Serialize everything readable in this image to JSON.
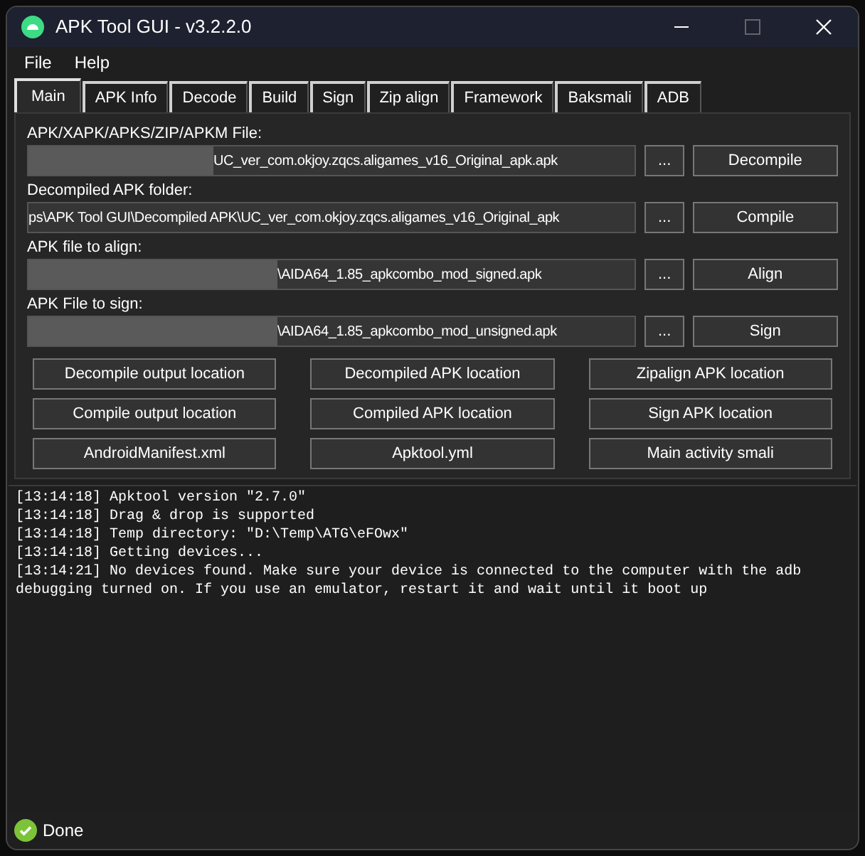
{
  "window": {
    "title": "APK Tool GUI - v3.2.2.0"
  },
  "menu": [
    "File",
    "Help"
  ],
  "tabs": [
    {
      "label": "Main",
      "selected": true
    },
    {
      "label": "APK Info",
      "selected": false
    },
    {
      "label": "Decode",
      "selected": false
    },
    {
      "label": "Build",
      "selected": false
    },
    {
      "label": "Sign",
      "selected": false
    },
    {
      "label": "Zip align",
      "selected": false
    },
    {
      "label": "Framework",
      "selected": false
    },
    {
      "label": "Baksmali",
      "selected": false
    },
    {
      "label": "ADB",
      "selected": false
    }
  ],
  "rows": [
    {
      "label": "APK/XAPK/APKS/ZIP/APKM File:",
      "value": "UC_ver_com.okjoy.zqcs.aligames_v16_Original_apk.apk",
      "blurred": true,
      "browse": "...",
      "action": "Decompile"
    },
    {
      "label": "Decompiled APK folder:",
      "value": "ps\\APK Tool GUI\\Decompiled APK\\UC_ver_com.okjoy.zqcs.aligames_v16_Original_apk",
      "blurred": false,
      "browse": "...",
      "action": "Compile"
    },
    {
      "label": "APK file to align:",
      "value": "\\AIDA64_1.85_apkcombo_mod_signed.apk",
      "blurred": true,
      "browse": "...",
      "action": "Align"
    },
    {
      "label": "APK File to sign:",
      "value": "\\AIDA64_1.85_apkcombo_mod_unsigned.apk",
      "blurred": true,
      "browse": "...",
      "action": "Sign"
    }
  ],
  "location_buttons": [
    "Decompile output location",
    "Decompiled APK location",
    "Zipalign APK location",
    "Compile output location",
    "Compiled APK location",
    "Sign APK location",
    "AndroidManifest.xml",
    "Apktool.yml",
    "Main activity smali"
  ],
  "log": [
    "[13:14:18] Apktool version \"2.7.0\"",
    "[13:14:18] Drag & drop is supported",
    "[13:14:18] Temp directory: \"D:\\Temp\\ATG\\eFOwx\"",
    "[13:14:18] Getting devices...",
    "[13:14:21] No devices found. Make sure your device is connected to the computer with the adb debugging turned on. If you use an emulator, restart it and wait until it boot up"
  ],
  "status_bar": {
    "text": "Done"
  }
}
